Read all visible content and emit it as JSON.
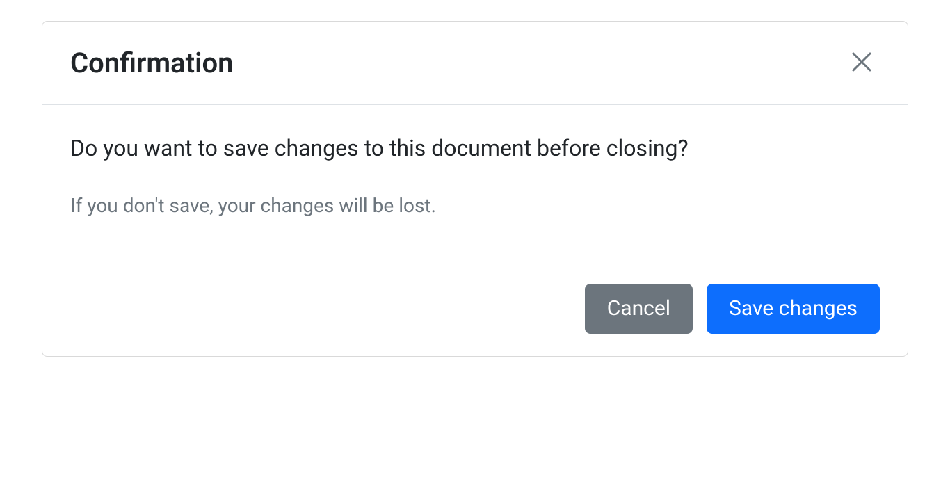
{
  "dialog": {
    "title": "Confirmation",
    "body": {
      "primary": "Do you want to save changes to this document before closing?",
      "secondary": "If you don't save, your changes will be lost."
    },
    "footer": {
      "cancel_label": "Cancel",
      "save_label": "Save changes"
    }
  }
}
